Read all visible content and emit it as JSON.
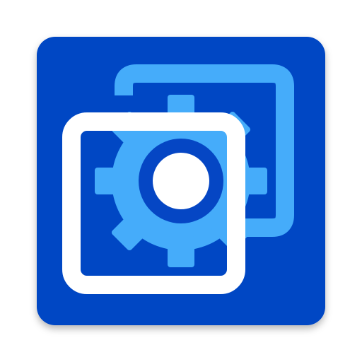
{
  "icon": {
    "name": "settings-gear-in-windows-icon",
    "colors": {
      "tile": "#0546C4",
      "tile_shadow": "#00000033",
      "light_blue": "#45ACFA",
      "white": "#FFFFFF"
    }
  }
}
